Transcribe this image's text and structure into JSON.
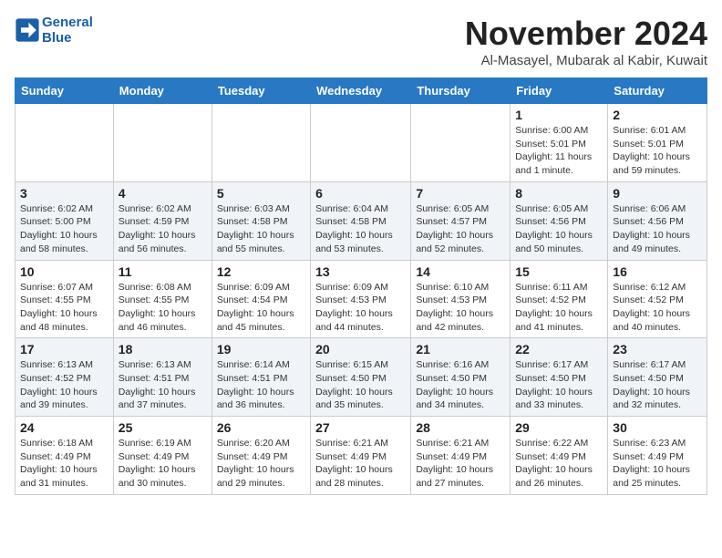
{
  "header": {
    "logo_line1": "General",
    "logo_line2": "Blue",
    "month_title": "November 2024",
    "subtitle": "Al-Masayel, Mubarak al Kabir, Kuwait"
  },
  "weekdays": [
    "Sunday",
    "Monday",
    "Tuesday",
    "Wednesday",
    "Thursday",
    "Friday",
    "Saturday"
  ],
  "weeks": [
    [
      {
        "day": "",
        "info": ""
      },
      {
        "day": "",
        "info": ""
      },
      {
        "day": "",
        "info": ""
      },
      {
        "day": "",
        "info": ""
      },
      {
        "day": "",
        "info": ""
      },
      {
        "day": "1",
        "info": "Sunrise: 6:00 AM\nSunset: 5:01 PM\nDaylight: 11 hours\nand 1 minute."
      },
      {
        "day": "2",
        "info": "Sunrise: 6:01 AM\nSunset: 5:01 PM\nDaylight: 10 hours\nand 59 minutes."
      }
    ],
    [
      {
        "day": "3",
        "info": "Sunrise: 6:02 AM\nSunset: 5:00 PM\nDaylight: 10 hours\nand 58 minutes."
      },
      {
        "day": "4",
        "info": "Sunrise: 6:02 AM\nSunset: 4:59 PM\nDaylight: 10 hours\nand 56 minutes."
      },
      {
        "day": "5",
        "info": "Sunrise: 6:03 AM\nSunset: 4:58 PM\nDaylight: 10 hours\nand 55 minutes."
      },
      {
        "day": "6",
        "info": "Sunrise: 6:04 AM\nSunset: 4:58 PM\nDaylight: 10 hours\nand 53 minutes."
      },
      {
        "day": "7",
        "info": "Sunrise: 6:05 AM\nSunset: 4:57 PM\nDaylight: 10 hours\nand 52 minutes."
      },
      {
        "day": "8",
        "info": "Sunrise: 6:05 AM\nSunset: 4:56 PM\nDaylight: 10 hours\nand 50 minutes."
      },
      {
        "day": "9",
        "info": "Sunrise: 6:06 AM\nSunset: 4:56 PM\nDaylight: 10 hours\nand 49 minutes."
      }
    ],
    [
      {
        "day": "10",
        "info": "Sunrise: 6:07 AM\nSunset: 4:55 PM\nDaylight: 10 hours\nand 48 minutes."
      },
      {
        "day": "11",
        "info": "Sunrise: 6:08 AM\nSunset: 4:55 PM\nDaylight: 10 hours\nand 46 minutes."
      },
      {
        "day": "12",
        "info": "Sunrise: 6:09 AM\nSunset: 4:54 PM\nDaylight: 10 hours\nand 45 minutes."
      },
      {
        "day": "13",
        "info": "Sunrise: 6:09 AM\nSunset: 4:53 PM\nDaylight: 10 hours\nand 44 minutes."
      },
      {
        "day": "14",
        "info": "Sunrise: 6:10 AM\nSunset: 4:53 PM\nDaylight: 10 hours\nand 42 minutes."
      },
      {
        "day": "15",
        "info": "Sunrise: 6:11 AM\nSunset: 4:52 PM\nDaylight: 10 hours\nand 41 minutes."
      },
      {
        "day": "16",
        "info": "Sunrise: 6:12 AM\nSunset: 4:52 PM\nDaylight: 10 hours\nand 40 minutes."
      }
    ],
    [
      {
        "day": "17",
        "info": "Sunrise: 6:13 AM\nSunset: 4:52 PM\nDaylight: 10 hours\nand 39 minutes."
      },
      {
        "day": "18",
        "info": "Sunrise: 6:13 AM\nSunset: 4:51 PM\nDaylight: 10 hours\nand 37 minutes."
      },
      {
        "day": "19",
        "info": "Sunrise: 6:14 AM\nSunset: 4:51 PM\nDaylight: 10 hours\nand 36 minutes."
      },
      {
        "day": "20",
        "info": "Sunrise: 6:15 AM\nSunset: 4:50 PM\nDaylight: 10 hours\nand 35 minutes."
      },
      {
        "day": "21",
        "info": "Sunrise: 6:16 AM\nSunset: 4:50 PM\nDaylight: 10 hours\nand 34 minutes."
      },
      {
        "day": "22",
        "info": "Sunrise: 6:17 AM\nSunset: 4:50 PM\nDaylight: 10 hours\nand 33 minutes."
      },
      {
        "day": "23",
        "info": "Sunrise: 6:17 AM\nSunset: 4:50 PM\nDaylight: 10 hours\nand 32 minutes."
      }
    ],
    [
      {
        "day": "24",
        "info": "Sunrise: 6:18 AM\nSunset: 4:49 PM\nDaylight: 10 hours\nand 31 minutes."
      },
      {
        "day": "25",
        "info": "Sunrise: 6:19 AM\nSunset: 4:49 PM\nDaylight: 10 hours\nand 30 minutes."
      },
      {
        "day": "26",
        "info": "Sunrise: 6:20 AM\nSunset: 4:49 PM\nDaylight: 10 hours\nand 29 minutes."
      },
      {
        "day": "27",
        "info": "Sunrise: 6:21 AM\nSunset: 4:49 PM\nDaylight: 10 hours\nand 28 minutes."
      },
      {
        "day": "28",
        "info": "Sunrise: 6:21 AM\nSunset: 4:49 PM\nDaylight: 10 hours\nand 27 minutes."
      },
      {
        "day": "29",
        "info": "Sunrise: 6:22 AM\nSunset: 4:49 PM\nDaylight: 10 hours\nand 26 minutes."
      },
      {
        "day": "30",
        "info": "Sunrise: 6:23 AM\nSunset: 4:49 PM\nDaylight: 10 hours\nand 25 minutes."
      }
    ]
  ]
}
